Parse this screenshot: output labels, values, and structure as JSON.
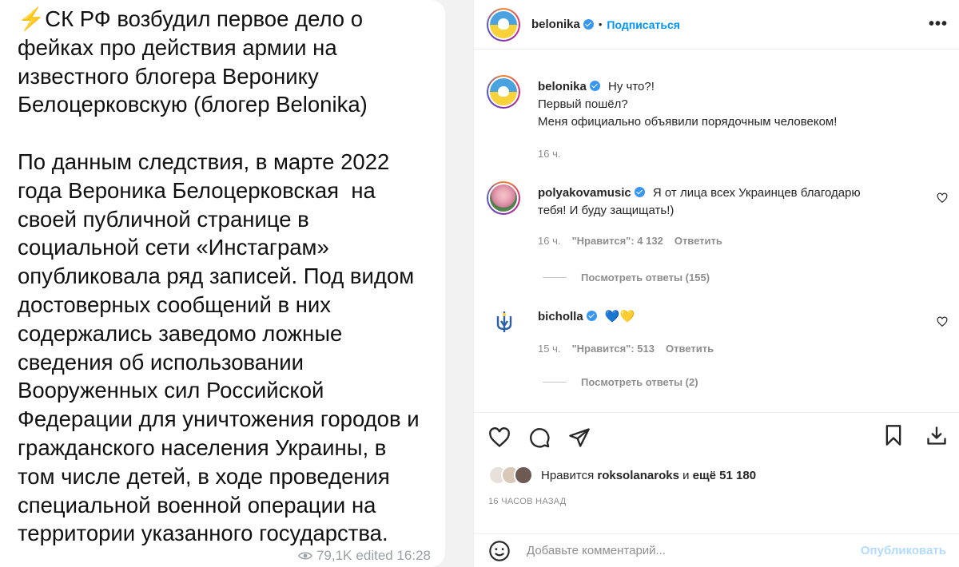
{
  "telegram_post": {
    "emoji": "⚡",
    "text": "СК РФ возбудил первое дело о фейках про действия армии на известного блогера Веронику Белоцерковскую (блогер Belonika)\n\nПо данным следствия, в марте 2022 года Вероника Белоцерковская  на своей публичной странице в социальной сети «Инстаграм» опубликовала ряд записей. Под видом достоверных сообщений в них содержались заведомо ложные сведения об использовании Вооруженных сил Российской Федерации для уничтожения городов и гражданского населения Украины, в том числе детей, в ходе проведения специальной военной операции на территории указанного государства.",
    "views": "79,1K",
    "edited": "edited 16:28"
  },
  "header": {
    "username": "belonika",
    "follow_label": "Подписаться",
    "more": "•••"
  },
  "caption": {
    "username": "belonika",
    "lines": [
      "Ну что?!",
      "Первый пошёл?",
      "Меня официально объявили порядочным человеком!"
    ],
    "time": "16 ч."
  },
  "comments": [
    {
      "username": "polyakovamusic",
      "text": "Я от лица всех Украинцев благодарю тебя! И буду защищать!)",
      "text_line1": "Я от лица всех Украинцев благодарю",
      "text_line2": "тебя! И буду защищать!)",
      "time": "16 ч.",
      "likes": "\"Нравится\": 4 132",
      "reply": "Ответить",
      "view_replies": "Посмотреть ответы (155)"
    },
    {
      "username": "bicholla",
      "text": "💙💛",
      "time": "15 ч.",
      "likes": "\"Нравится\": 513",
      "reply": "Ответить",
      "view_replies": "Посмотреть ответы (2)"
    }
  ],
  "likes_bar": {
    "prefix": "Нравится",
    "user": "roksolanaroks",
    "middle": "и",
    "count": "ещё 51 180"
  },
  "post_date": "16 ЧАСОВ НАЗАД",
  "add_comment": {
    "placeholder": "Добавьте комментарий...",
    "publish_label": "Опубликовать"
  },
  "colors": {
    "accent": "#0095f6",
    "verified": "#3897f0",
    "muted": "#8e8e8e"
  }
}
